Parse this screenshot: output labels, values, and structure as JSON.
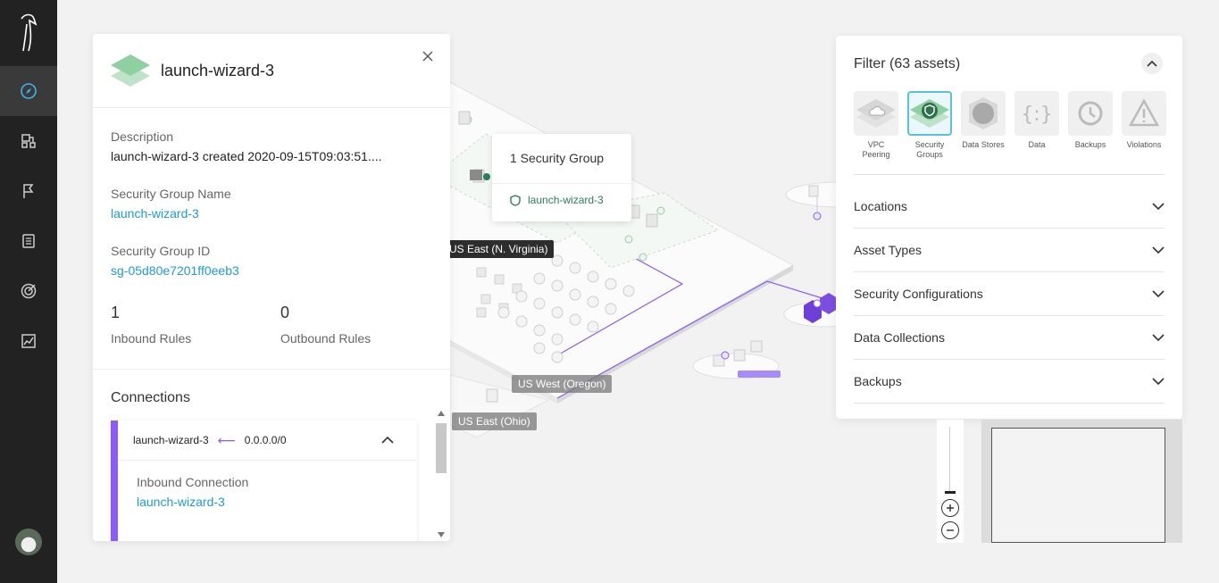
{
  "sidebar": {
    "items": [
      {
        "icon": "compass-icon",
        "active": true
      },
      {
        "icon": "topology-icon"
      },
      {
        "icon": "flag-icon"
      },
      {
        "icon": "document-list-icon"
      },
      {
        "icon": "target-icon"
      },
      {
        "icon": "chart-icon"
      }
    ]
  },
  "map": {
    "regions": [
      "US East (N. Virginia)",
      "US West (Oregon)",
      "US East (Ohio)"
    ]
  },
  "tooltip": {
    "title": "1 Security Group",
    "item": "launch-wizard-3"
  },
  "details": {
    "title": "launch-wizard-3",
    "description_label": "Description",
    "description_value": "launch-wizard-3 created 2020-09-15T09:03:51....",
    "name_label": "Security Group Name",
    "name_value": "launch-wizard-3",
    "id_label": "Security Group ID",
    "id_value": "sg-05d80e7201ff0eeb3",
    "inbound_count": "1",
    "inbound_label": "Inbound Rules",
    "outbound_count": "0",
    "outbound_label": "Outbound Rules",
    "connections_label": "Connections",
    "connection": {
      "source": "launch-wizard-3",
      "arrow": "⟵",
      "target": "0.0.0.0/0",
      "type_label": "Inbound Connection",
      "type_value": "launch-wizard-3"
    }
  },
  "filter": {
    "title": "Filter (63 assets)",
    "asset_tiles": [
      {
        "label": "VPC Peering",
        "icon": "cloud-icon",
        "selected": false
      },
      {
        "label": "Security Groups",
        "icon": "shield-icon",
        "selected": true
      },
      {
        "label": "Data Stores",
        "icon": "datastore-icon",
        "selected": false
      },
      {
        "label": "Data",
        "icon": "braces-icon",
        "selected": false
      },
      {
        "label": "Backups",
        "icon": "clock-icon",
        "selected": false
      },
      {
        "label": "Violations",
        "icon": "warning-icon",
        "selected": false
      }
    ],
    "sections": [
      "Locations",
      "Asset Types",
      "Security Configurations",
      "Data Collections",
      "Backups"
    ]
  },
  "colors": {
    "accent_blue": "#1e9bd7",
    "connection_purple": "#8b5cf6",
    "security_green": "#2e7d5b"
  }
}
